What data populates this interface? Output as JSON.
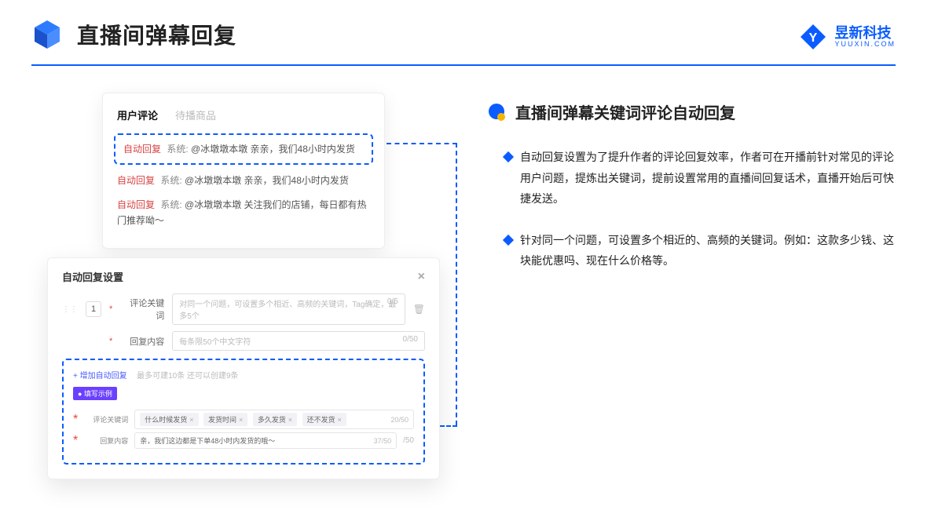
{
  "header": {
    "title": "直播间弹幕回复"
  },
  "brand": {
    "cn": "昱新科技",
    "en": "YUUXIN.COM"
  },
  "comments_card": {
    "tab_active": "用户评论",
    "tab_inactive": "待播商品",
    "c1_tag": "自动回复",
    "c1_sys": "系统: ",
    "c1_txt": "@冰墩墩本墩 亲亲，我们48小时内发货",
    "c2_tag": "自动回复",
    "c2_sys": "系统: ",
    "c2_txt": "@冰墩墩本墩 亲亲，我们48小时内发货",
    "c3_tag": "自动回复",
    "c3_sys": "系统: ",
    "c3_txt": "@冰墩墩本墩 关注我们的店铺，每日都有热门推荐呦～"
  },
  "settings_card": {
    "title": "自动回复设置",
    "num": "1",
    "row1_label": "评论关键词",
    "row1_placeholder": "对同一个问题，可设置多个相近、高频的关键词，Tag确定，最多5个",
    "row1_count": "0/5",
    "row2_label": "回复内容",
    "row2_placeholder": "每条限50个中文字符",
    "row2_count": "0/50",
    "add_link": "+ 增加自动回复",
    "add_hint": "最多可建10条 还可以创建9条",
    "pill": "● 填写示例",
    "ex_kw_label": "评论关键词",
    "ex_kw_tags": [
      "什么时候发货",
      "发货时间",
      "多久发货",
      "还不发货"
    ],
    "ex_kw_count": "20/50",
    "ex_reply_label": "回复内容",
    "ex_reply_text": "亲，我们这边都是下单48小时内发货的哦～",
    "ex_reply_count": "37/50",
    "outer_count": "/50"
  },
  "right": {
    "title": "直播间弹幕关键词评论自动回复",
    "b1": "自动回复设置为了提升作者的评论回复效率，作者可在开播前针对常见的评论用户问题，提炼出关键词，提前设置常用的直播间回复话术，直播开始后可快捷发送。",
    "b2": "针对同一个问题，可设置多个相近的、高频的关键词。例如：这款多少钱、这块能优惠吗、现在什么价格等。"
  }
}
